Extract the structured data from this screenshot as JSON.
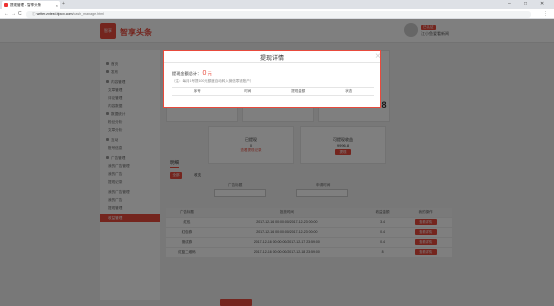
{
  "browser": {
    "tab_title": "提现管理 - 智享头条",
    "close_glyph": "×",
    "new_tab_glyph": "+",
    "url_host": "writer.zxtest.bjxcx.com",
    "url_path": "/cash_manage.html",
    "back_glyph": "←",
    "forward_glyph": "→",
    "reload_glyph": "C",
    "lock_glyph": "ⓘ",
    "menu_glyph": "⋮",
    "minimize_glyph": "–",
    "maximize_glyph": "□",
    "window_close_glyph": "✕"
  },
  "header": {
    "logo_mark": "智享",
    "brand": "智享头条",
    "user_badge": "已认证",
    "user_name": "江小鱼爱看新闻"
  },
  "sidebar": {
    "items": [
      {
        "label": "首页",
        "kind": "head"
      },
      {
        "label": "发布",
        "kind": "head"
      },
      {
        "label": "内容管理",
        "kind": "head"
      },
      {
        "label": "文章管理",
        "kind": "sub"
      },
      {
        "label": "评论管理",
        "kind": "sub"
      },
      {
        "label": "内容数据",
        "kind": "sub"
      },
      {
        "label": "数据统计",
        "kind": "head"
      },
      {
        "label": "粉丝分析",
        "kind": "sub"
      },
      {
        "label": "文章分析",
        "kind": "sub"
      },
      {
        "label": "互动",
        "kind": "head"
      },
      {
        "label": "账号信息",
        "kind": "sub"
      },
      {
        "label": "广告管理",
        "kind": "head"
      },
      {
        "label": "我的广告管理",
        "kind": "sub"
      },
      {
        "label": "我的广告",
        "kind": "sub"
      },
      {
        "label": "提现记录",
        "kind": "sub"
      },
      {
        "label": "我的广告管理",
        "kind": "sub"
      },
      {
        "label": "我的广告",
        "kind": "sub"
      },
      {
        "label": "提现管理",
        "kind": "sub"
      },
      {
        "label": "收益管理",
        "kind": "active"
      }
    ]
  },
  "main": {
    "big_number": "6.8",
    "panels": [
      {
        "title": "已提现",
        "value": "0",
        "link": "查看提现记录"
      },
      {
        "title": "可提现收益",
        "value": "9996.8",
        "button": "提现"
      }
    ],
    "section_tab": "明细",
    "filter_button": "全部",
    "filter_option": "收支",
    "filter_labels": [
      "广告标题",
      "申请时间"
    ],
    "table": {
      "headers": [
        "广告标题",
        "投放时间",
        "收益金额",
        "我的操作"
      ],
      "rows": [
        [
          "红包",
          "2017-12-16 00:00:00/2017-12-23 00:00",
          "3.4",
          "查看详情"
        ],
        [
          "红包券",
          "2017-12-16 00:00:00/2017-12-23 00:00",
          "0.4",
          "查看详情"
        ],
        [
          "测试券",
          "2017-12-16 00:00:00/2017-12-17 23:59:00",
          "0.4",
          "查看详情"
        ],
        [
          "红蓝二维码",
          "2017-12-16 00:00:00/2017-12-18 23:59:00",
          "8",
          "查看详情"
        ]
      ]
    }
  },
  "modal": {
    "title": "提现详情",
    "amount_label": "提现金额总计：",
    "amount_value": "0",
    "amount_unit": "元",
    "note": "（注：每月1号提100元额度自动转入微信零钱账户）",
    "columns": [
      "序号",
      "时间",
      "提现金额",
      "状态"
    ],
    "close_glyph": "×"
  },
  "colors": {
    "accent": "#e84a3c",
    "overlay": "rgba(0,0,0,0.5)"
  }
}
